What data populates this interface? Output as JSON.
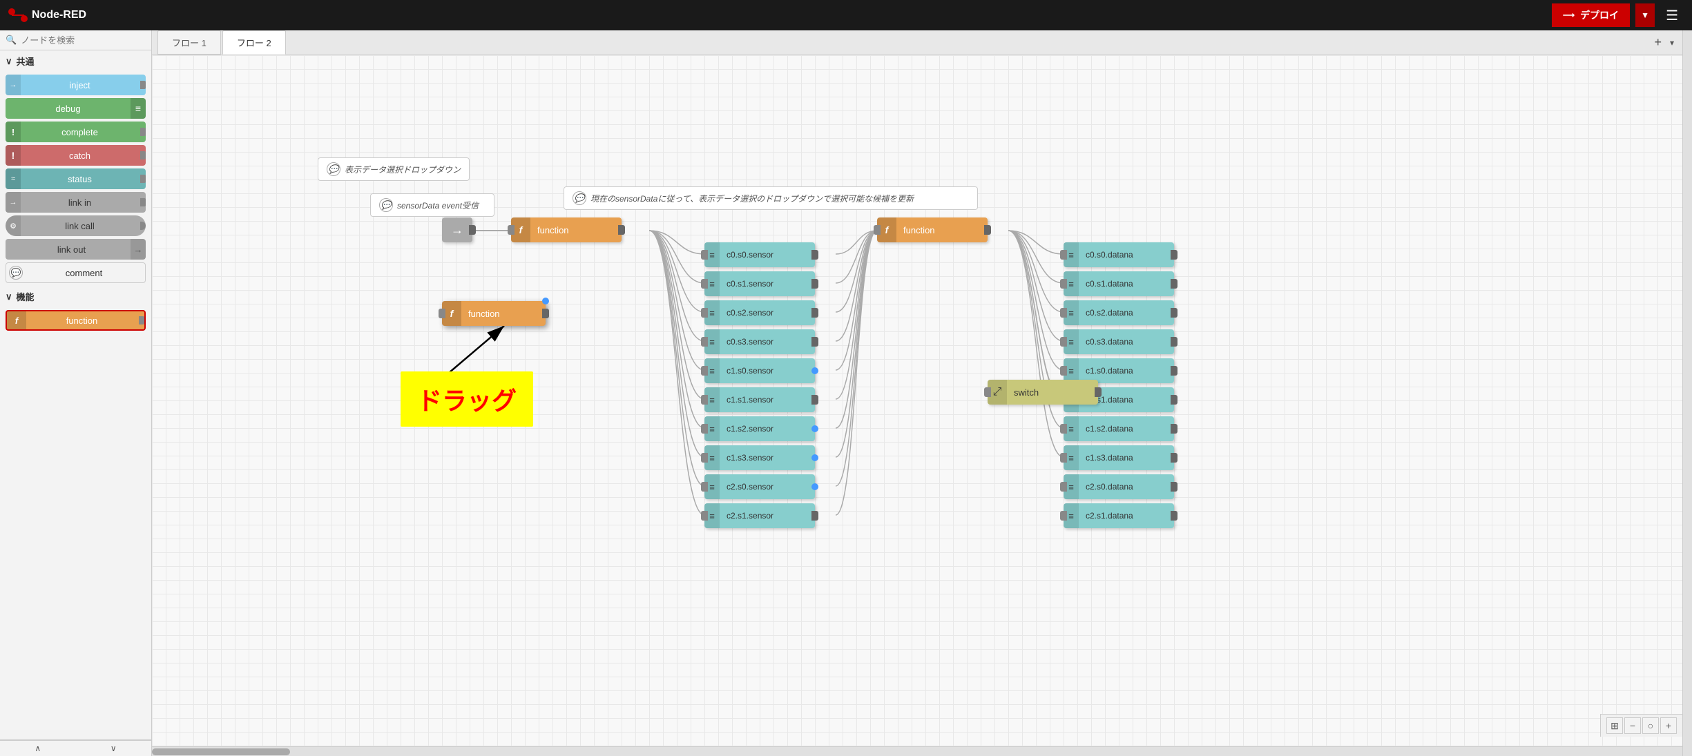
{
  "header": {
    "title": "Node-RED",
    "deploy_label": "デプロイ",
    "deploy_dropdown": "▼",
    "hamburger": "☰"
  },
  "sidebar": {
    "search_placeholder": "ノードを検索",
    "sections": [
      {
        "name": "共通",
        "nodes": [
          {
            "id": "inject",
            "label": "inject",
            "type": "inject"
          },
          {
            "id": "debug",
            "label": "debug",
            "type": "debug"
          },
          {
            "id": "complete",
            "label": "complete",
            "type": "complete"
          },
          {
            "id": "catch",
            "label": "catch",
            "type": "catch"
          },
          {
            "id": "status",
            "label": "status",
            "type": "status"
          },
          {
            "id": "link-in",
            "label": "link in",
            "type": "linkin"
          },
          {
            "id": "link-call",
            "label": "link call",
            "type": "linkcall"
          },
          {
            "id": "link-out",
            "label": "link out",
            "type": "linkout"
          },
          {
            "id": "comment",
            "label": "comment",
            "type": "comment"
          }
        ]
      },
      {
        "name": "機能",
        "nodes": [
          {
            "id": "function",
            "label": "function",
            "type": "function"
          }
        ]
      }
    ]
  },
  "tabs": [
    {
      "label": "フロー 1",
      "active": false
    },
    {
      "label": "フロー 2",
      "active": true
    }
  ],
  "canvas": {
    "comment1": "表示データ選択ドロップダウン",
    "comment2": "sensorData event受信",
    "comment3": "現在のsensorDataに従って、表示データ選択のドロップダウンで選択可能な候補を更新",
    "drag_label": "ドラッグ",
    "nodes": {
      "function1_label": "function",
      "function2_label": "function",
      "function3_label": "function",
      "sensor_nodes": [
        "c0.s0.sensor",
        "c0.s1.sensor",
        "c0.s2.sensor",
        "c0.s3.sensor",
        "c1.s0.sensor",
        "c1.s1.sensor",
        "c1.s2.sensor",
        "c1.s3.sensor",
        "c2.s0.sensor",
        "c2.s1.sensor"
      ],
      "data_nodes": [
        "c0.s0.datana",
        "c0.s1.datana",
        "c0.s2.datana",
        "c0.s3.datana",
        "c1.s0.datana",
        "c1.s1.datana",
        "c1.s2.datana",
        "c1.s3.datana",
        "c2.s0.datana",
        "c2.s1.datana"
      ],
      "switch_label": "switch"
    }
  },
  "bottom_tools": [
    "⊞",
    "−",
    "○",
    "+"
  ]
}
